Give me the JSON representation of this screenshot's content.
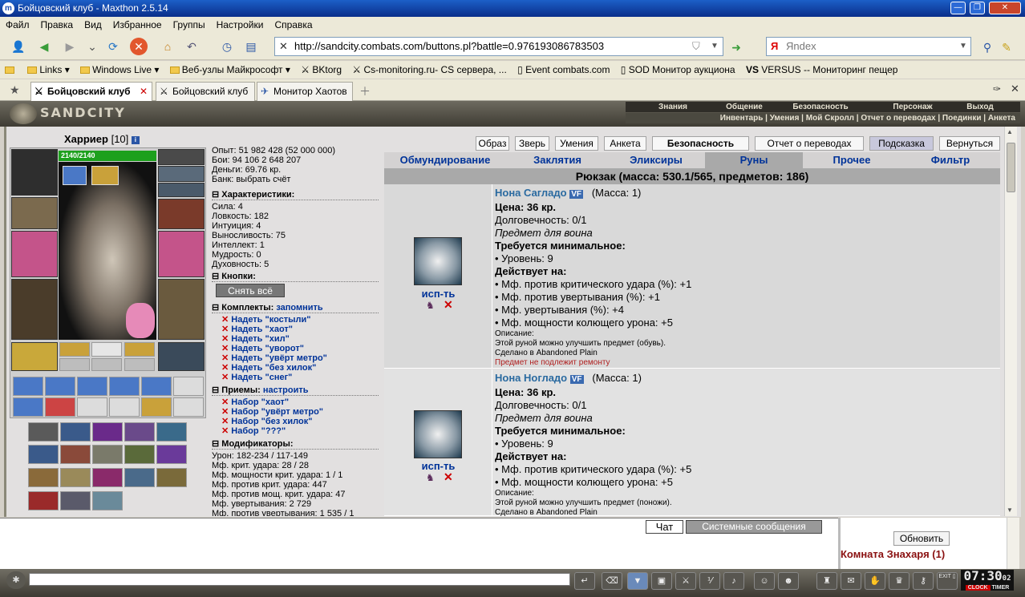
{
  "window": {
    "title": "Бойцовский клуб - Maxthon 2.5.14"
  },
  "menu": [
    "Файл",
    "Правка",
    "Вид",
    "Избранное",
    "Группы",
    "Настройки",
    "Справка"
  ],
  "address": {
    "url": "http://sandcity.combats.com/buttons.pl?battle=0.976193086783503"
  },
  "search": {
    "placeholder": "Яndex"
  },
  "bookmarks": [
    "Links",
    "Windows Live",
    "Веб-узлы Майкрософт",
    "BKtorg",
    "Cs-monitoring.ru- CS сервера, ...",
    "Event combats.com",
    "SOD Монитор аукциона",
    "VERSUS -- Мониторинг пещер"
  ],
  "tabs": [
    {
      "label": "Бойцовский клуб"
    },
    {
      "label": "Бойцовский клуб"
    },
    {
      "label": "Монитор Хаотов"
    }
  ],
  "game": {
    "logo": "SANDCITY",
    "menu1": [
      "Знания",
      "Общение",
      "Безопасность",
      "Персонаж",
      "Выход"
    ],
    "menu2": "Инвентарь | Умения | Мой Скролл | Отчет о переводах | Поединки | Анкета",
    "char": {
      "name": "Харриер",
      "level": "[10]",
      "hp": "2140/2140"
    },
    "stats": {
      "exp": "Опыт: 51 982 428 (52 000 000)",
      "battles": "Бои:  94 106   2 648   207",
      "money": "Деньги: 69.76 кр.",
      "bank": "Банк: выбрать счёт"
    },
    "sections": {
      "chars": "Характеристики:",
      "buttons": "Кнопки:",
      "sets": "Комплекты:",
      "sets_link": "запомнить",
      "tricks": "Приемы:",
      "tricks_link": "настроить",
      "mods": "Модификаторы:"
    },
    "attributes": [
      "Сила: 4",
      "Ловкость: 182",
      "Интуиция: 4",
      "Выносливость: 75",
      "Интеллект: 1",
      "Мудрость: 0",
      "Духовность: 5"
    ],
    "remove_all": "Снять всё",
    "sets": [
      "Надеть \"костыли\"",
      "Надеть \"хаот\"",
      "Надеть \"хил\"",
      "Надеть \"уворот\"",
      "Надеть \"увёрт метро\"",
      "Надеть \"без хилок\"",
      "Надеть \"снег\""
    ],
    "tricks": [
      "Набор \"хаот\"",
      "Набор \"увёрт метро\"",
      "Набор \"без хилок\"",
      "Набор \"???\""
    ],
    "mods": [
      "Урон: 182-234 / 117-149",
      "Мф. крит. удара: 28 / 28",
      "Мф. мощности крит. удара: 1 / 1",
      "Мф. против крит. удара: 447",
      "Мф. против мощ. крит. удара: 47",
      "Мф. увертывания: 2 729",
      "Мф. против увертывания: 1 535 / 1"
    ],
    "topbuttons": [
      "Образ",
      "Зверь",
      "Умения",
      "Анкета",
      "Безопасность",
      "Отчет о переводах",
      "Подсказка",
      "Вернуться"
    ],
    "nav": [
      "Обмундирование",
      "Заклятия",
      "Эликсиры",
      "Руны",
      "Прочее",
      "Фильтр"
    ],
    "backpack": "Рюкзак (масса: 530.1/565, предметов: 186)",
    "items": [
      {
        "name": "Нона Сагладо",
        "badge": "VF",
        "mass": "(Масса: 1)",
        "price": "Цена: 36 кр.",
        "dur": "Долговечность: 0/1",
        "for": "Предмет для воина",
        "req": "Требуется минимальное:",
        "lvl": "• Уровень: 9",
        "acts": "Действует на:",
        "effects": [
          "• Мф. против критического удара (%): +1",
          "• Мф. против увертывания (%): +1",
          "• Мф. увертывания (%): +4",
          "• Мф. мощности колющего урона: +5"
        ],
        "desc": "Описание:",
        "desc1": "Этой руной можно улучшить предмет (обувь).",
        "made": "Сделано в Abandoned Plain",
        "norepair": "Предмет не подлежит ремонту",
        "use": "исп-ть"
      },
      {
        "name": "Нона Ногладо",
        "badge": "VF",
        "mass": "(Масса: 1)",
        "price": "Цена: 36 кр.",
        "dur": "Долговечность: 0/1",
        "for": "Предмет для воина",
        "req": "Требуется минимальное:",
        "lvl": "• Уровень: 9",
        "acts": "Действует на:",
        "effects": [
          "• Мф. против критического удара (%): +5",
          "• Мф. мощности колющего урона: +5"
        ],
        "desc": "Описание:",
        "desc1": "Этой руной можно улучшить предмет (поножи).",
        "made": "Сделано в Abandoned Plain",
        "use": "исп-ть"
      }
    ]
  },
  "chat": {
    "tab1": "Чат",
    "tab2": "Системные сообщения",
    "refresh": "Обновить",
    "room": "Комната Знахаря (1)"
  },
  "clock": {
    "time": "07:30",
    "sec": "02",
    "labels": [
      "CLOCK",
      "TIMER"
    ]
  }
}
